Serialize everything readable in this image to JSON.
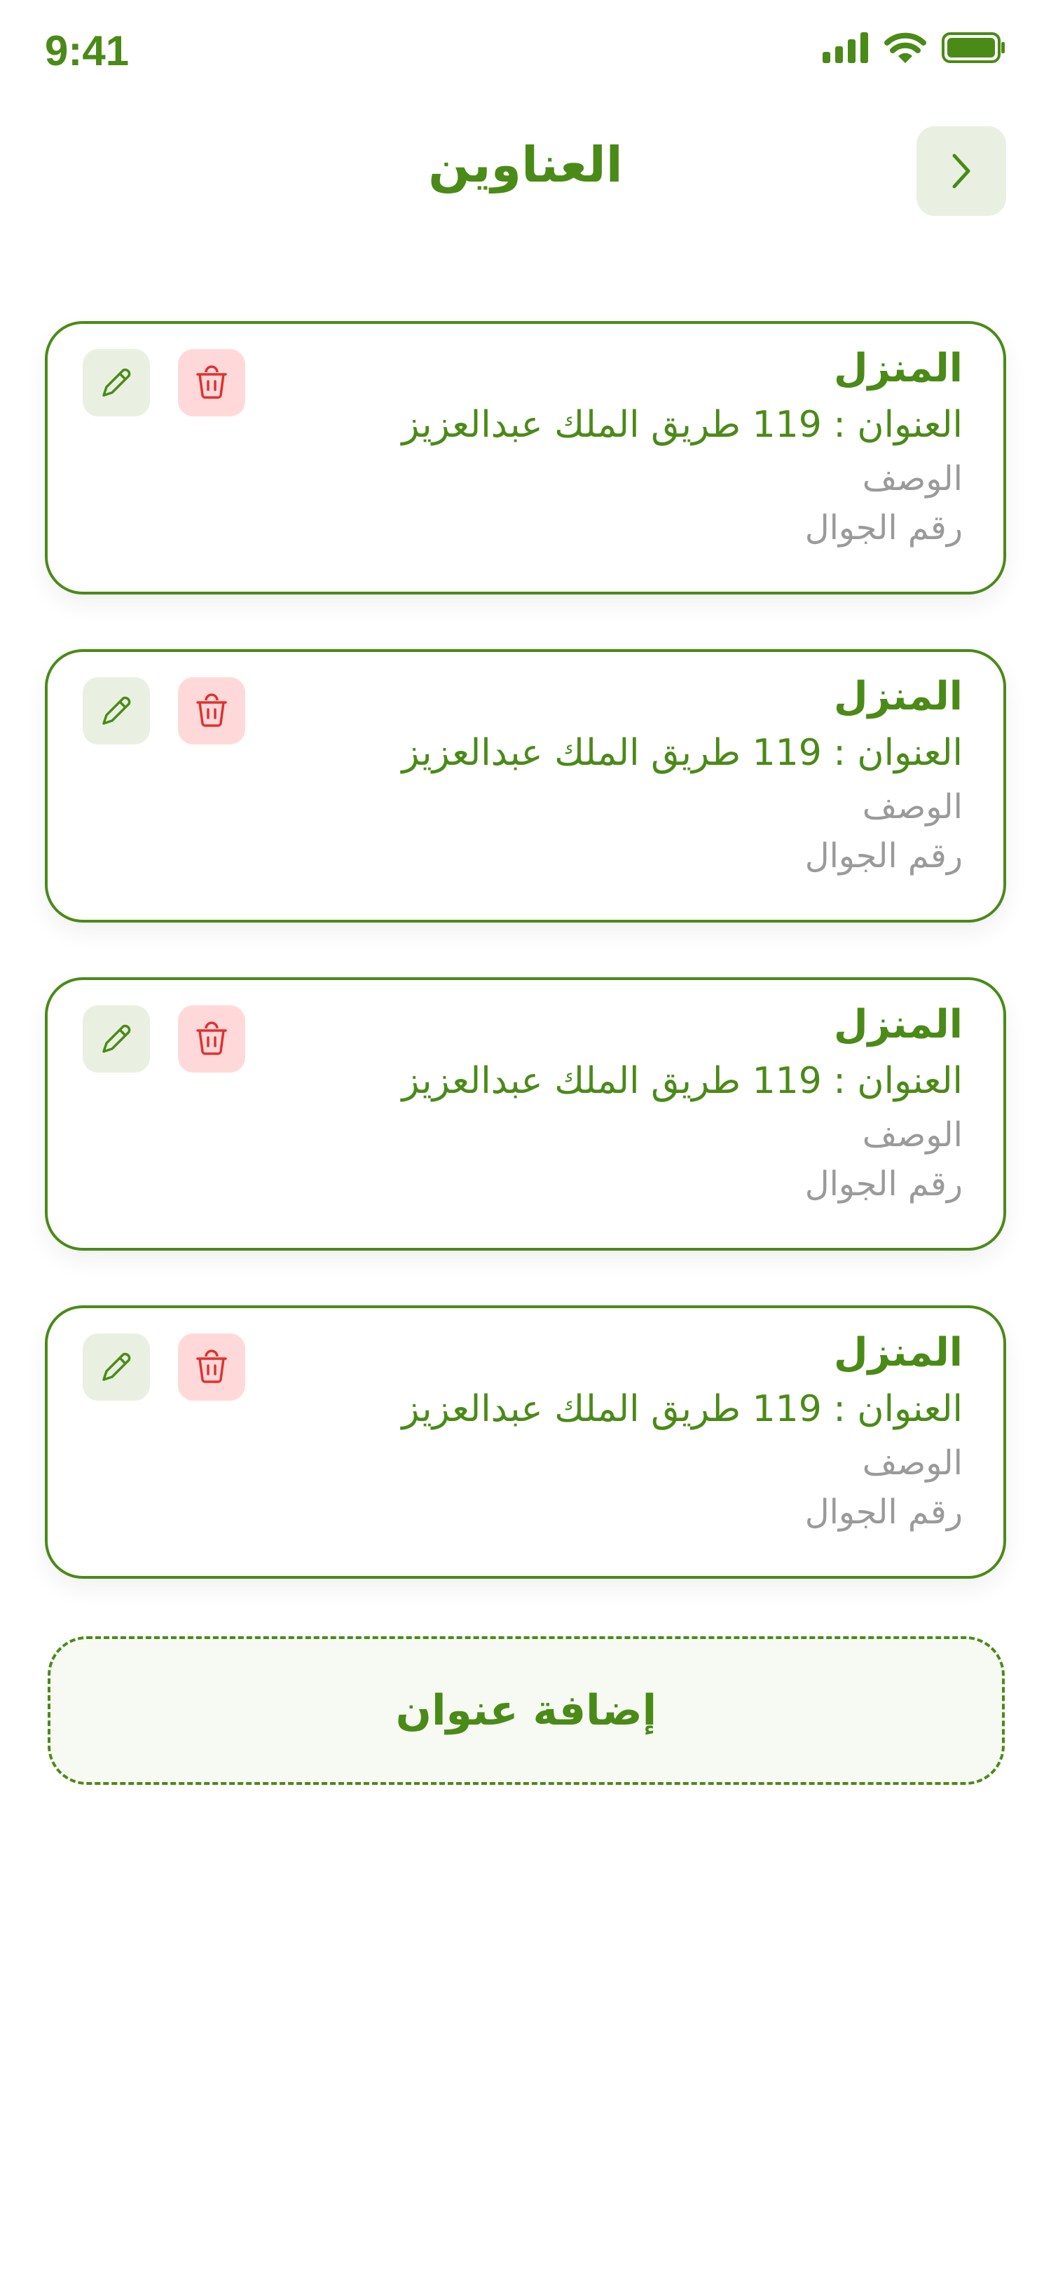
{
  "status_bar": {
    "time": "9:41",
    "icons": [
      "signal-icon",
      "wifi-icon",
      "battery-icon"
    ]
  },
  "header": {
    "title": "العناوين",
    "back_icon": "chevron-right-icon"
  },
  "cards": [
    {
      "title": "المنزل",
      "address": "العنوان : 119 طريق الملك عبدالعزيز",
      "description": "الوصف",
      "phone": "رقم الجوال"
    },
    {
      "title": "المنزل",
      "address": "العنوان : 119 طريق الملك عبدالعزيز",
      "description": "الوصف",
      "phone": "رقم الجوال"
    },
    {
      "title": "المنزل",
      "address": "العنوان : 119 طريق الملك عبدالعزيز",
      "description": "الوصف",
      "phone": "رقم الجوال"
    },
    {
      "title": "المنزل",
      "address": "العنوان : 119 طريق الملك عبدالعزيز",
      "description": "الوصف",
      "phone": "رقم الجوال"
    }
  ],
  "add_button": {
    "label": "إضافة عنوان"
  },
  "colors": {
    "primary": "#4a8a17",
    "primary_bg": "#e9f0e2",
    "danger": "#e0312f",
    "danger_bg": "#ffd9d9",
    "muted_text": "#9a9a9a"
  }
}
